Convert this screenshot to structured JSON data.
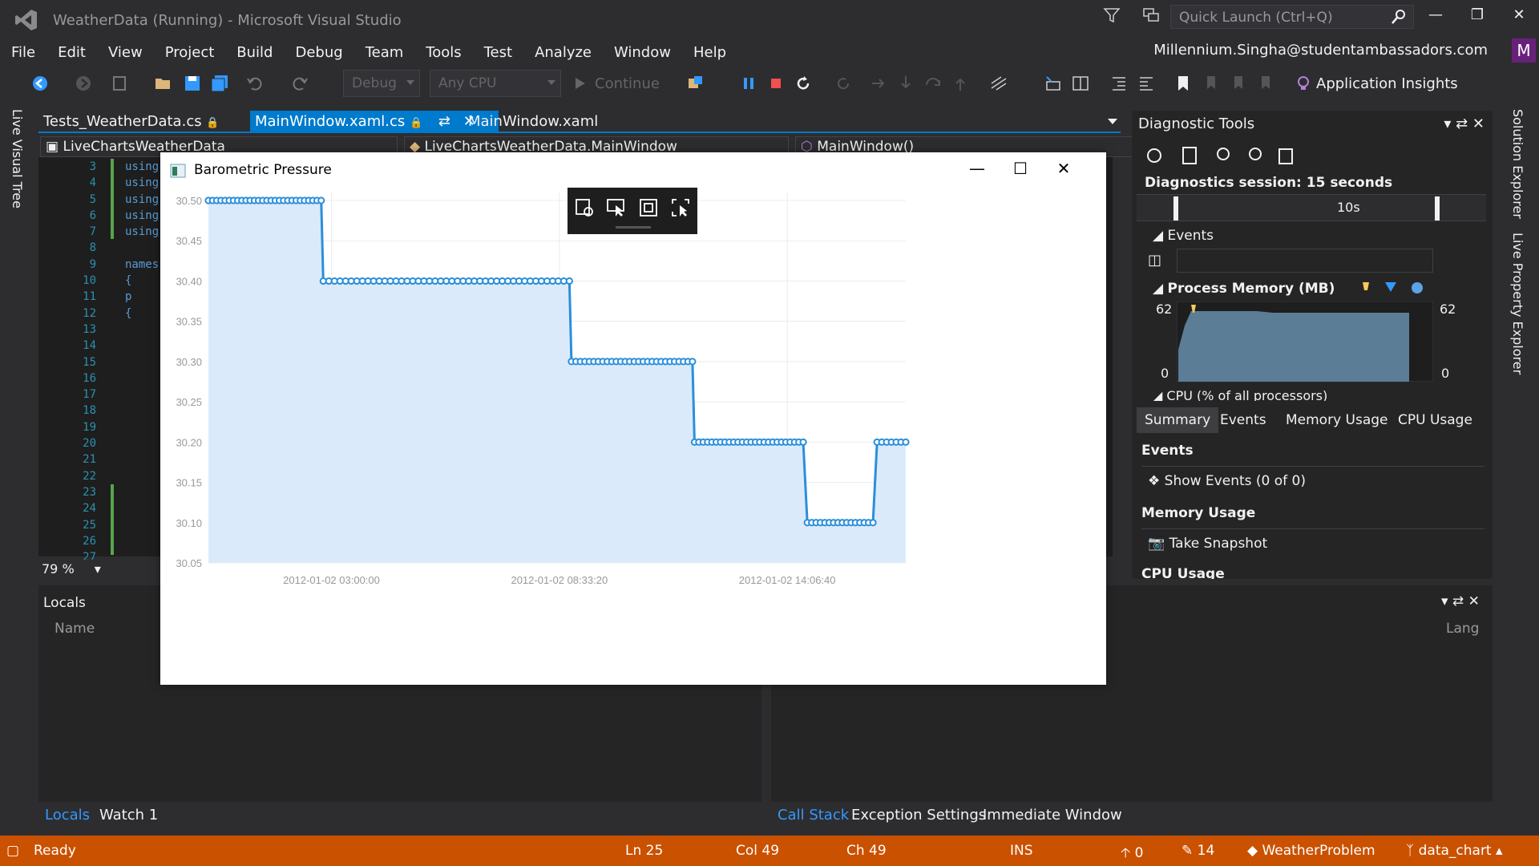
{
  "window": {
    "title": "WeatherData (Running) - Microsoft Visual Studio",
    "quick_launch_placeholder": "Quick Launch (Ctrl+Q)",
    "account": "Millennium.Singha@studentambassadors.com",
    "avatar_letter": "M"
  },
  "menu": [
    "File",
    "Edit",
    "View",
    "Project",
    "Build",
    "Debug",
    "Team",
    "Tools",
    "Test",
    "Analyze",
    "Window",
    "Help"
  ],
  "toolbar": {
    "config": "Debug",
    "platform": "Any CPU",
    "continue_label": "Continue",
    "app_insights": "Application Insights"
  },
  "left_vtab": "Live Visual Tree",
  "right_vtabs": [
    "Solution Explorer",
    "Live Property Explorer"
  ],
  "doc_tabs": [
    {
      "label": "Tests_WeatherData.cs",
      "active": false
    },
    {
      "label": "MainWindow.xaml.cs",
      "active": true
    },
    {
      "label": "MainWindow.xaml",
      "active": false
    }
  ],
  "nav": {
    "project": "LiveChartsWeatherData",
    "class": "LiveChartsWeatherData.MainWindow",
    "member": "MainWindow()"
  },
  "editor": {
    "line_numbers": [
      "3",
      "4",
      "5",
      "6",
      "7",
      "8",
      "9",
      "10",
      "11",
      "12",
      "13",
      "14",
      "15",
      "16",
      "17",
      "18",
      "19",
      "20",
      "21",
      "22",
      "23",
      "24",
      "25",
      "26",
      "27"
    ],
    "code": [
      "using",
      "using",
      "using",
      "using",
      "using",
      "",
      "names",
      "{",
      "p",
      "{"
    ],
    "zoom": "79 %"
  },
  "locals": {
    "title": "Locals",
    "column_name": "Name",
    "tabs": [
      "Locals",
      "Watch 1"
    ]
  },
  "callstack": {
    "column_lang": "Lang",
    "tabs": [
      "Call Stack",
      "Exception Settings",
      "Immediate Window"
    ]
  },
  "diagnostics": {
    "title": "Diagnostic Tools",
    "session": "Diagnostics session: 15 seconds",
    "timeline_label": "10s",
    "events_label": "Events",
    "memory_label": "Process Memory (MB)",
    "memory_max": "62",
    "memory_min": "0",
    "cpu_label": "CPU (% of all processors)",
    "tabs": [
      "Summary",
      "Events",
      "Memory Usage",
      "CPU Usage"
    ],
    "summary_events_header": "Events",
    "show_events": "Show Events (0 of 0)",
    "memory_usage_header": "Memory Usage",
    "take_snapshot": "Take Snapshot",
    "cpu_usage_header": "CPU Usage"
  },
  "status": {
    "ready": "Ready",
    "ln": "Ln 25",
    "col": "Col 49",
    "ch": "Ch 49",
    "ins": "INS",
    "up_count": "0",
    "pencil_count": "14",
    "repo": "WeatherProblem",
    "branch": "data_chart"
  },
  "chart_window": {
    "title": "Barometric Pressure"
  },
  "chart_data": {
    "type": "area",
    "title": "",
    "xlabel": "",
    "ylabel": "",
    "ylim": [
      30.05,
      30.5
    ],
    "yticks": [
      "30.50",
      "30.45",
      "30.40",
      "30.35",
      "30.30",
      "30.25",
      "30.20",
      "30.15",
      "30.10",
      "30.05"
    ],
    "xtick_labels": [
      "2012-01-02 03:00:00",
      "2012-01-02 08:33:20",
      "2012-01-02 14:06:40"
    ],
    "x_start": "2012-01-02 00:00:00",
    "x_end": "2012-01-02 17:00:00",
    "grid": true,
    "fill_color": "#dbeafb",
    "line_color": "#2a8fdb",
    "segments": [
      {
        "from_hour": 0.0,
        "to_hour": 2.75,
        "value": 30.5,
        "points": 28
      },
      {
        "from_hour": 2.8,
        "to_hour": 8.8,
        "value": 30.4,
        "points": 45
      },
      {
        "from_hour": 8.85,
        "to_hour": 11.8,
        "value": 30.3,
        "points": 28
      },
      {
        "from_hour": 11.85,
        "to_hour": 14.5,
        "value": 30.2,
        "points": 26
      },
      {
        "from_hour": 14.6,
        "to_hour": 16.2,
        "value": 30.1,
        "points": 16
      },
      {
        "from_hour": 16.3,
        "to_hour": 17.0,
        "value": 30.2,
        "points": 7
      }
    ]
  }
}
